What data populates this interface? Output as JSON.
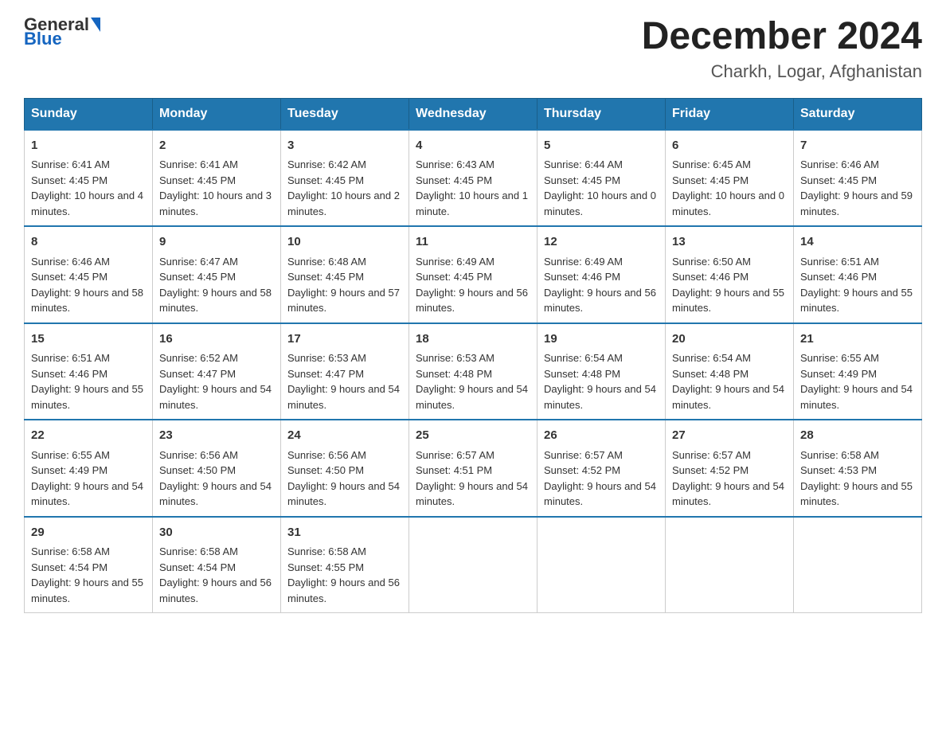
{
  "header": {
    "logo_text_general": "General",
    "logo_text_blue": "Blue",
    "month_title": "December 2024",
    "location": "Charkh, Logar, Afghanistan"
  },
  "weekdays": [
    "Sunday",
    "Monday",
    "Tuesday",
    "Wednesday",
    "Thursday",
    "Friday",
    "Saturday"
  ],
  "weeks": [
    [
      {
        "day": "1",
        "sunrise": "6:41 AM",
        "sunset": "4:45 PM",
        "daylight": "10 hours and 4 minutes."
      },
      {
        "day": "2",
        "sunrise": "6:41 AM",
        "sunset": "4:45 PM",
        "daylight": "10 hours and 3 minutes."
      },
      {
        "day": "3",
        "sunrise": "6:42 AM",
        "sunset": "4:45 PM",
        "daylight": "10 hours and 2 minutes."
      },
      {
        "day": "4",
        "sunrise": "6:43 AM",
        "sunset": "4:45 PM",
        "daylight": "10 hours and 1 minute."
      },
      {
        "day": "5",
        "sunrise": "6:44 AM",
        "sunset": "4:45 PM",
        "daylight": "10 hours and 0 minutes."
      },
      {
        "day": "6",
        "sunrise": "6:45 AM",
        "sunset": "4:45 PM",
        "daylight": "10 hours and 0 minutes."
      },
      {
        "day": "7",
        "sunrise": "6:46 AM",
        "sunset": "4:45 PM",
        "daylight": "9 hours and 59 minutes."
      }
    ],
    [
      {
        "day": "8",
        "sunrise": "6:46 AM",
        "sunset": "4:45 PM",
        "daylight": "9 hours and 58 minutes."
      },
      {
        "day": "9",
        "sunrise": "6:47 AM",
        "sunset": "4:45 PM",
        "daylight": "9 hours and 58 minutes."
      },
      {
        "day": "10",
        "sunrise": "6:48 AM",
        "sunset": "4:45 PM",
        "daylight": "9 hours and 57 minutes."
      },
      {
        "day": "11",
        "sunrise": "6:49 AM",
        "sunset": "4:45 PM",
        "daylight": "9 hours and 56 minutes."
      },
      {
        "day": "12",
        "sunrise": "6:49 AM",
        "sunset": "4:46 PM",
        "daylight": "9 hours and 56 minutes."
      },
      {
        "day": "13",
        "sunrise": "6:50 AM",
        "sunset": "4:46 PM",
        "daylight": "9 hours and 55 minutes."
      },
      {
        "day": "14",
        "sunrise": "6:51 AM",
        "sunset": "4:46 PM",
        "daylight": "9 hours and 55 minutes."
      }
    ],
    [
      {
        "day": "15",
        "sunrise": "6:51 AM",
        "sunset": "4:46 PM",
        "daylight": "9 hours and 55 minutes."
      },
      {
        "day": "16",
        "sunrise": "6:52 AM",
        "sunset": "4:47 PM",
        "daylight": "9 hours and 54 minutes."
      },
      {
        "day": "17",
        "sunrise": "6:53 AM",
        "sunset": "4:47 PM",
        "daylight": "9 hours and 54 minutes."
      },
      {
        "day": "18",
        "sunrise": "6:53 AM",
        "sunset": "4:48 PM",
        "daylight": "9 hours and 54 minutes."
      },
      {
        "day": "19",
        "sunrise": "6:54 AM",
        "sunset": "4:48 PM",
        "daylight": "9 hours and 54 minutes."
      },
      {
        "day": "20",
        "sunrise": "6:54 AM",
        "sunset": "4:48 PM",
        "daylight": "9 hours and 54 minutes."
      },
      {
        "day": "21",
        "sunrise": "6:55 AM",
        "sunset": "4:49 PM",
        "daylight": "9 hours and 54 minutes."
      }
    ],
    [
      {
        "day": "22",
        "sunrise": "6:55 AM",
        "sunset": "4:49 PM",
        "daylight": "9 hours and 54 minutes."
      },
      {
        "day": "23",
        "sunrise": "6:56 AM",
        "sunset": "4:50 PM",
        "daylight": "9 hours and 54 minutes."
      },
      {
        "day": "24",
        "sunrise": "6:56 AM",
        "sunset": "4:50 PM",
        "daylight": "9 hours and 54 minutes."
      },
      {
        "day": "25",
        "sunrise": "6:57 AM",
        "sunset": "4:51 PM",
        "daylight": "9 hours and 54 minutes."
      },
      {
        "day": "26",
        "sunrise": "6:57 AM",
        "sunset": "4:52 PM",
        "daylight": "9 hours and 54 minutes."
      },
      {
        "day": "27",
        "sunrise": "6:57 AM",
        "sunset": "4:52 PM",
        "daylight": "9 hours and 54 minutes."
      },
      {
        "day": "28",
        "sunrise": "6:58 AM",
        "sunset": "4:53 PM",
        "daylight": "9 hours and 55 minutes."
      }
    ],
    [
      {
        "day": "29",
        "sunrise": "6:58 AM",
        "sunset": "4:54 PM",
        "daylight": "9 hours and 55 minutes."
      },
      {
        "day": "30",
        "sunrise": "6:58 AM",
        "sunset": "4:54 PM",
        "daylight": "9 hours and 56 minutes."
      },
      {
        "day": "31",
        "sunrise": "6:58 AM",
        "sunset": "4:55 PM",
        "daylight": "9 hours and 56 minutes."
      },
      null,
      null,
      null,
      null
    ]
  ]
}
